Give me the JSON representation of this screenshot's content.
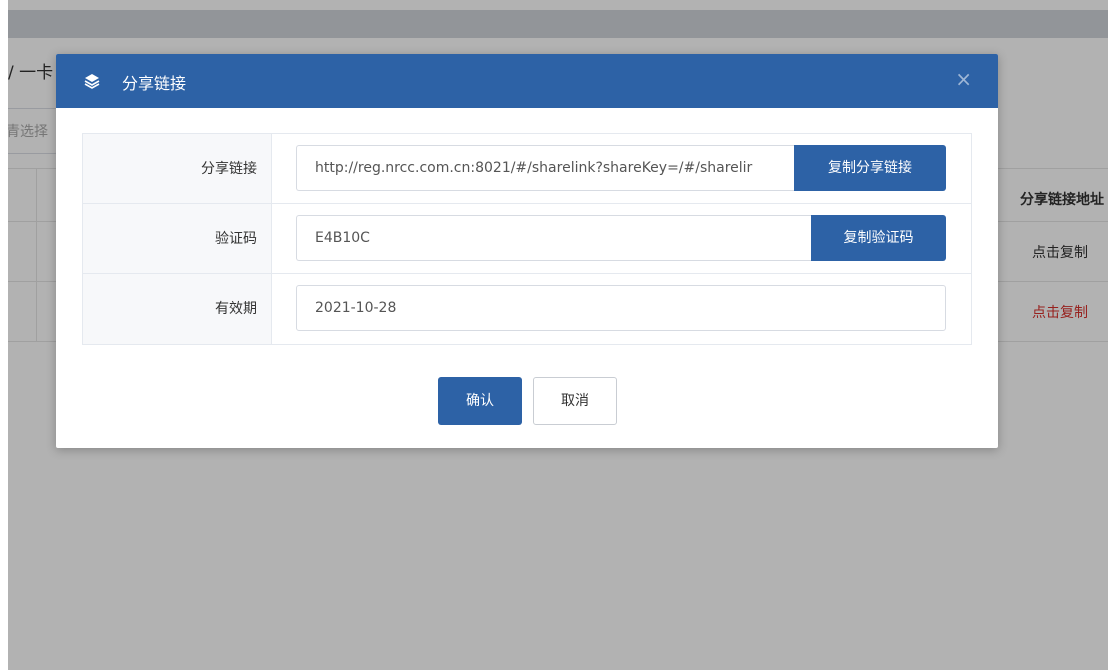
{
  "background": {
    "breadcrumb": "/ 一卡",
    "select_placeholder": "青选择",
    "table_header_last": "分享链接地址",
    "rows": [
      {
        "link_text": "点击复制"
      },
      {
        "link_text": "点击复制"
      }
    ]
  },
  "modal": {
    "icon": "layers-icon",
    "title": "分享链接",
    "close_symbol": "×",
    "fields": {
      "share_link": {
        "label": "分享链接",
        "value": "http://reg.nrcc.com.cn:8021/#/sharelink?shareKey=/#/sharelir",
        "button_label": "复制分享链接"
      },
      "verify_code": {
        "label": "验证码",
        "value": "E4B10C",
        "button_label": "复制验证码"
      },
      "expiry": {
        "label": "有效期",
        "value": "2021-10-28"
      }
    },
    "confirm_label": "确认",
    "cancel_label": "取消"
  },
  "colors": {
    "primary": "#2d62a6",
    "link_red": "#d9302c"
  }
}
